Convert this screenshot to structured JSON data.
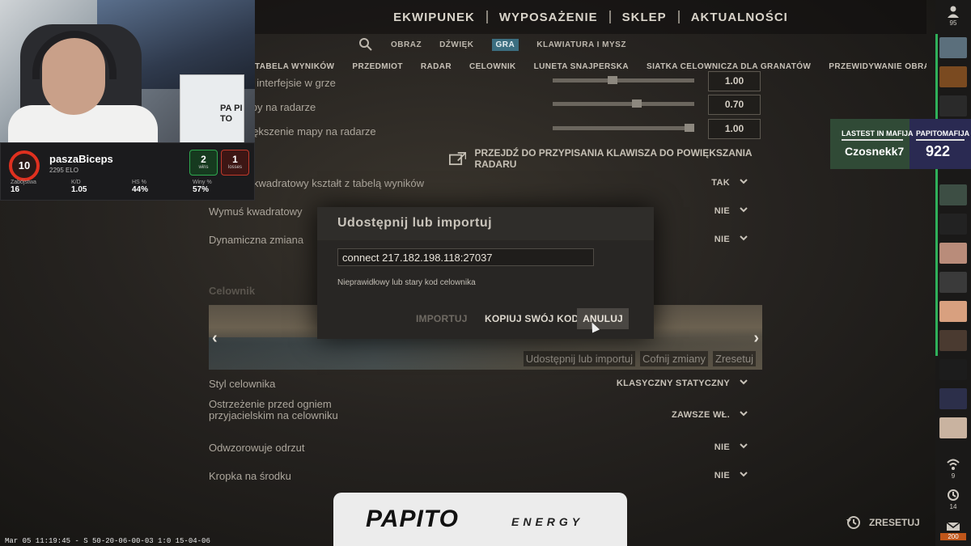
{
  "top_nav": [
    "EKWIPUNEK",
    "WYPOSAŻENIE",
    "SKLEP",
    "AKTUALNOŚCI"
  ],
  "sub_nav": [
    "OBRAZ",
    "DŹWIĘK",
    "GRA",
    "KLAWIATURA I MYSZ"
  ],
  "sub_nav_active": "GRA",
  "tabs": [
    "TABELA WYNIKÓW",
    "PRZEDMIOT",
    "RADAR",
    "CELOWNIK",
    "LUNETA SNAJPERSKA",
    "SIATKA CELOWNICZA DLA GRANATÓW",
    "PRZEWIDYWANIE OBRAŻE"
  ],
  "settings": {
    "r1_label": "radaru na interfejsie w grze",
    "r1_value": "1.00",
    "r1_slider": 0.42,
    "r2_label": "zenie mapy na radarze",
    "r2_value": "0.70",
    "r2_slider": 0.6,
    "r3_label": "wne powiększenie mapy na radarze",
    "r3_value": "1.00",
    "r3_slider": 1.0,
    "link_label": "PRZEJDŹ DO PRZYPISANIA KLAWISZA DO POWIĘKSZANIA RADARU",
    "r4_label": "kwadratowy kształt z tabelą wyników",
    "r4_value": "TAK",
    "r5_label": "Wymuś kwadratowy",
    "r5_value": "NIE",
    "r6_label": "Dynamiczna zmiana",
    "r6_value": "NIE",
    "crosshair_section": "Celownik",
    "preview_buttons": [
      "Udostępnij lub importuj",
      "Cofnij zmiany",
      "Zresetuj"
    ],
    "r7_label": "Styl celownika",
    "r7_value": "KLASYCZNY STATYCZNY",
    "r8_label": "Ostrzeżenie przed ogniem przyjacielskim na celowniku",
    "r8_value": "ZAWSZE WŁ.",
    "r9_label": "Odwzorowuje odrzut",
    "r9_value": "NIE",
    "r10_label": "Kropka na środku",
    "r10_value": "NIE"
  },
  "dialog": {
    "title": "Udostępnij lub importuj",
    "input_value": "connect 217.182.198.118:27037",
    "error": "Nieprawidłowy lub stary kod celownika",
    "import_btn": "IMPORTUJ",
    "copy_btn": "KOPIUJ SWÓJ KOD",
    "cancel_btn": "ANULUJ"
  },
  "faceit": {
    "level": "10",
    "name": "paszaBiceps",
    "elo": "2295 ELO",
    "wins": "2",
    "wins_label": "wins",
    "losses": "1",
    "losses_label": "losses",
    "stats": [
      {
        "label": "Zabójstwa",
        "value": "16"
      },
      {
        "label": "K/D",
        "value": "1.05"
      },
      {
        "label": "HS %",
        "value": "44%"
      },
      {
        "label": "Winy %",
        "value": "57%"
      }
    ]
  },
  "cam_text": "PA PI TO",
  "mafia": {
    "label1": "LASTEST IN MAFIJA",
    "label2": "PAPITOMAFIJA",
    "name": "Czosnekk7",
    "score": "922"
  },
  "sidebar": {
    "friends_count": "95",
    "wifi_count": "9",
    "history_count": "14",
    "mail_count": "200"
  },
  "sponsor": {
    "brand": "PAPITO",
    "sub": "ENERGY"
  },
  "reset_label": "ZRESETUJ",
  "timestamp": "Mar 05 11:19:45 - S 50-20-06-00-03 1:0 15-04-06",
  "colors": {
    "accent_tab": "#3c6e80",
    "faceit_red": "#e0301f",
    "win": "#2fa84f",
    "loss": "#c0392b"
  }
}
